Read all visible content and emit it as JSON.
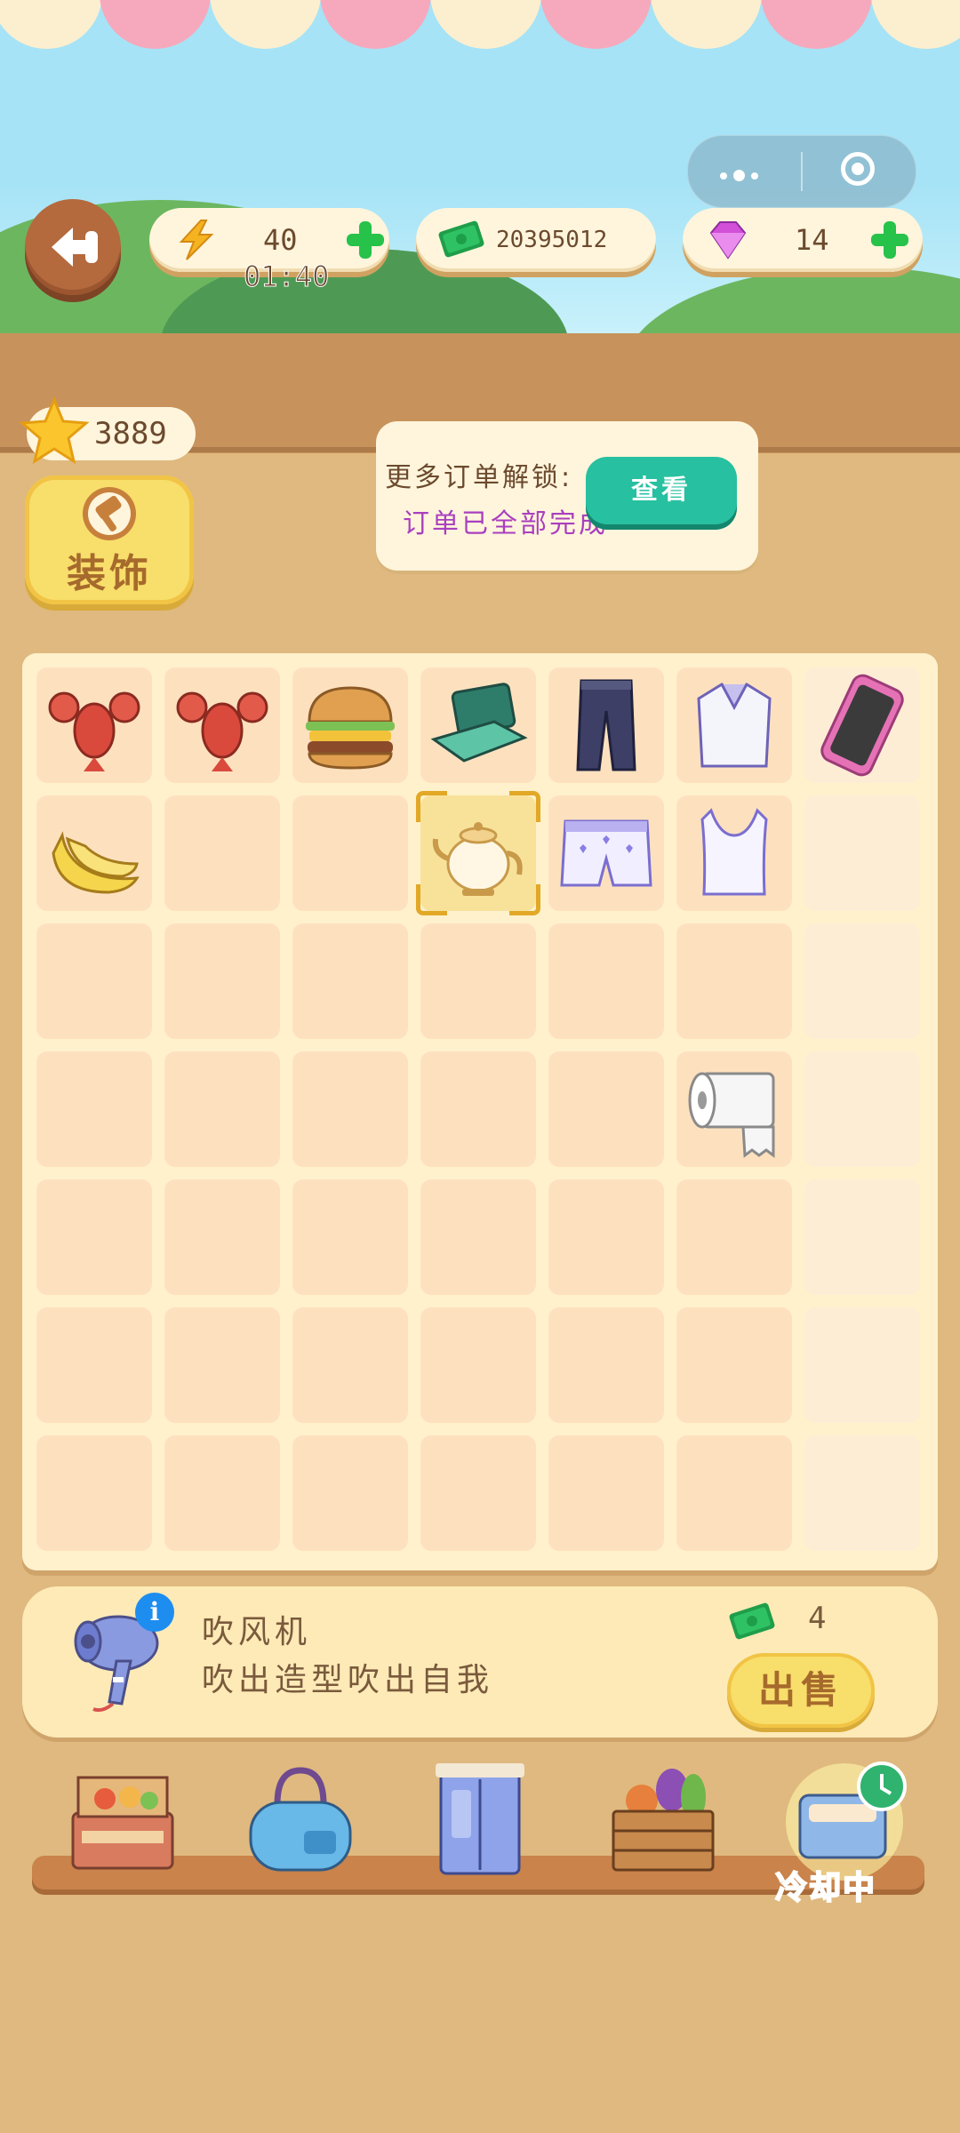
{
  "hud": {
    "energy": {
      "value": "40",
      "timer": "01:40",
      "icon": "lightning-icon"
    },
    "cash": {
      "value": "20395012",
      "icon": "cash-icon"
    },
    "gems": {
      "value": "14",
      "icon": "gem-icon"
    }
  },
  "stars": {
    "value": "3889"
  },
  "decorate": {
    "label": "装饰"
  },
  "orders": {
    "line1": "更多订单解锁:",
    "line2": "订单已全部完成",
    "view_label": "查看"
  },
  "board": {
    "rows": 7,
    "cols": 7,
    "items": [
      {
        "row": 0,
        "col": 0,
        "name": "lobster"
      },
      {
        "row": 0,
        "col": 1,
        "name": "lobster"
      },
      {
        "row": 0,
        "col": 2,
        "name": "hamburger"
      },
      {
        "row": 0,
        "col": 3,
        "name": "laptop"
      },
      {
        "row": 0,
        "col": 4,
        "name": "jeans"
      },
      {
        "row": 0,
        "col": 5,
        "name": "shirt"
      },
      {
        "row": 0,
        "col": 6,
        "name": "smartphone"
      },
      {
        "row": 1,
        "col": 0,
        "name": "bananas"
      },
      {
        "row": 1,
        "col": 3,
        "name": "teapot",
        "selected": true
      },
      {
        "row": 1,
        "col": 4,
        "name": "boxer-shorts"
      },
      {
        "row": 1,
        "col": 5,
        "name": "tank-top"
      },
      {
        "row": 3,
        "col": 5,
        "name": "toilet-paper"
      }
    ]
  },
  "selected_item": {
    "name": "吹风机",
    "description": "吹出造型吹出自我",
    "price": "4",
    "sell_label": "出售",
    "icon": "hair-dryer-icon"
  },
  "generators": [
    {
      "name": "food-stand"
    },
    {
      "name": "handbag"
    },
    {
      "name": "wardrobe"
    },
    {
      "name": "vegetable-crate"
    },
    {
      "name": "laundry-basket",
      "status": "冷却中"
    }
  ]
}
